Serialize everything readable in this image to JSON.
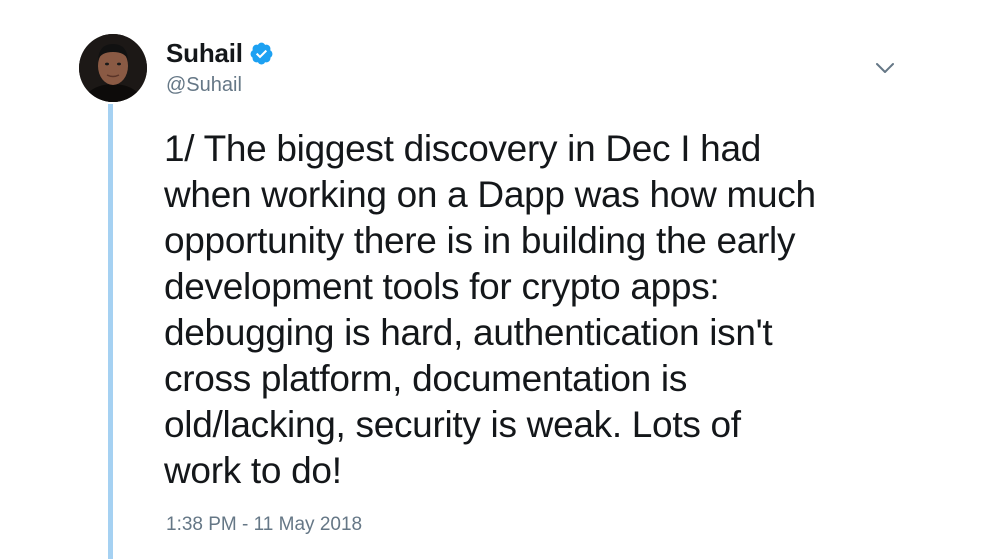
{
  "user": {
    "display_name": "Suhail",
    "handle": "@Suhail",
    "verified": true,
    "avatar_icon": "person-avatar"
  },
  "tweet": {
    "text": "1/ The biggest discovery in Dec I had\nwhen working on a Dapp was how much\nopportunity there is in building the early\ndevelopment tools for crypto apps:\ndebugging is hard, authentication isn't\ncross platform, documentation is\nold/lacking, security is weak. Lots of\nwork to do!",
    "timestamp": "1:38 PM - 11 May 2018"
  },
  "icons": {
    "verified": "verified-badge-icon",
    "menu": "chevron-down-icon"
  },
  "colors": {
    "thread_line": "#a5d1f2",
    "verified_blue": "#1da1f2",
    "secondary_text": "#657786",
    "primary_text": "#14171a"
  }
}
